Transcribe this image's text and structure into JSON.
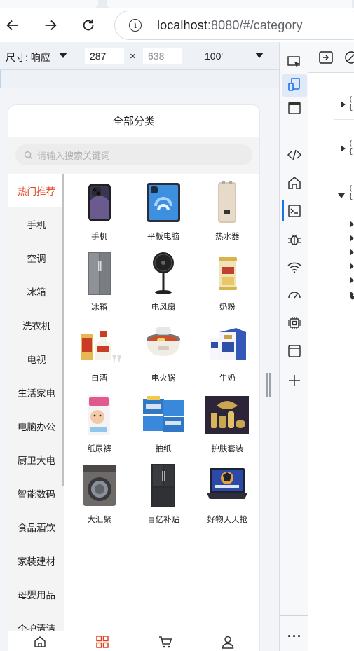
{
  "browser": {
    "url_host": "localhost",
    "url_rest": ":8080/#/category",
    "back_icon": "arrow-left-icon",
    "forward_icon": "arrow-right-icon",
    "reload_icon": "reload-icon",
    "info_glyph": "i"
  },
  "devtools_toolbar": {
    "dimensions_label": "尺寸: 响应",
    "width": "287",
    "height": "638",
    "times": "×",
    "zoom": "100'"
  },
  "page": {
    "title": "全部分类",
    "search_placeholder": "请输入搜索关键词"
  },
  "sidebar": {
    "items": [
      {
        "label": "热门推荐",
        "active": true
      },
      {
        "label": "手机"
      },
      {
        "label": "空调"
      },
      {
        "label": "冰箱"
      },
      {
        "label": "洗衣机"
      },
      {
        "label": "电视"
      },
      {
        "label": "生活家电"
      },
      {
        "label": "电脑办公"
      },
      {
        "label": "厨卫大电"
      },
      {
        "label": "智能数码"
      },
      {
        "label": "食品酒饮"
      },
      {
        "label": "家装建材"
      },
      {
        "label": "母婴用品"
      },
      {
        "label": "个护清洁"
      }
    ]
  },
  "products": [
    {
      "name": "手机",
      "icon": "phone"
    },
    {
      "name": "平板电脑",
      "icon": "tablet"
    },
    {
      "name": "热水器",
      "icon": "water-heater"
    },
    {
      "name": "冰箱",
      "icon": "fridge"
    },
    {
      "name": "电风扇",
      "icon": "fan"
    },
    {
      "name": "奶粉",
      "icon": "milk-powder"
    },
    {
      "name": "白酒",
      "icon": "liquor"
    },
    {
      "name": "电火锅",
      "icon": "hotpot"
    },
    {
      "name": "牛奶",
      "icon": "milk-box"
    },
    {
      "name": "纸尿裤",
      "icon": "diapers"
    },
    {
      "name": "抽纸",
      "icon": "tissue"
    },
    {
      "name": "护肤套装",
      "icon": "skincare-set"
    },
    {
      "name": "大汇聚",
      "icon": "washing-machine"
    },
    {
      "name": "百亿补贴",
      "icon": "double-door-fridge"
    },
    {
      "name": "好物天天抢",
      "icon": "laptop"
    }
  ],
  "tabbar": {
    "items": [
      {
        "icon": "home-icon"
      },
      {
        "icon": "category-icon",
        "active": true
      },
      {
        "icon": "cart-icon"
      },
      {
        "icon": "user-icon"
      }
    ]
  },
  "colors": {
    "accent": "#e2421f",
    "devtools_blue": "#1a73e8"
  }
}
